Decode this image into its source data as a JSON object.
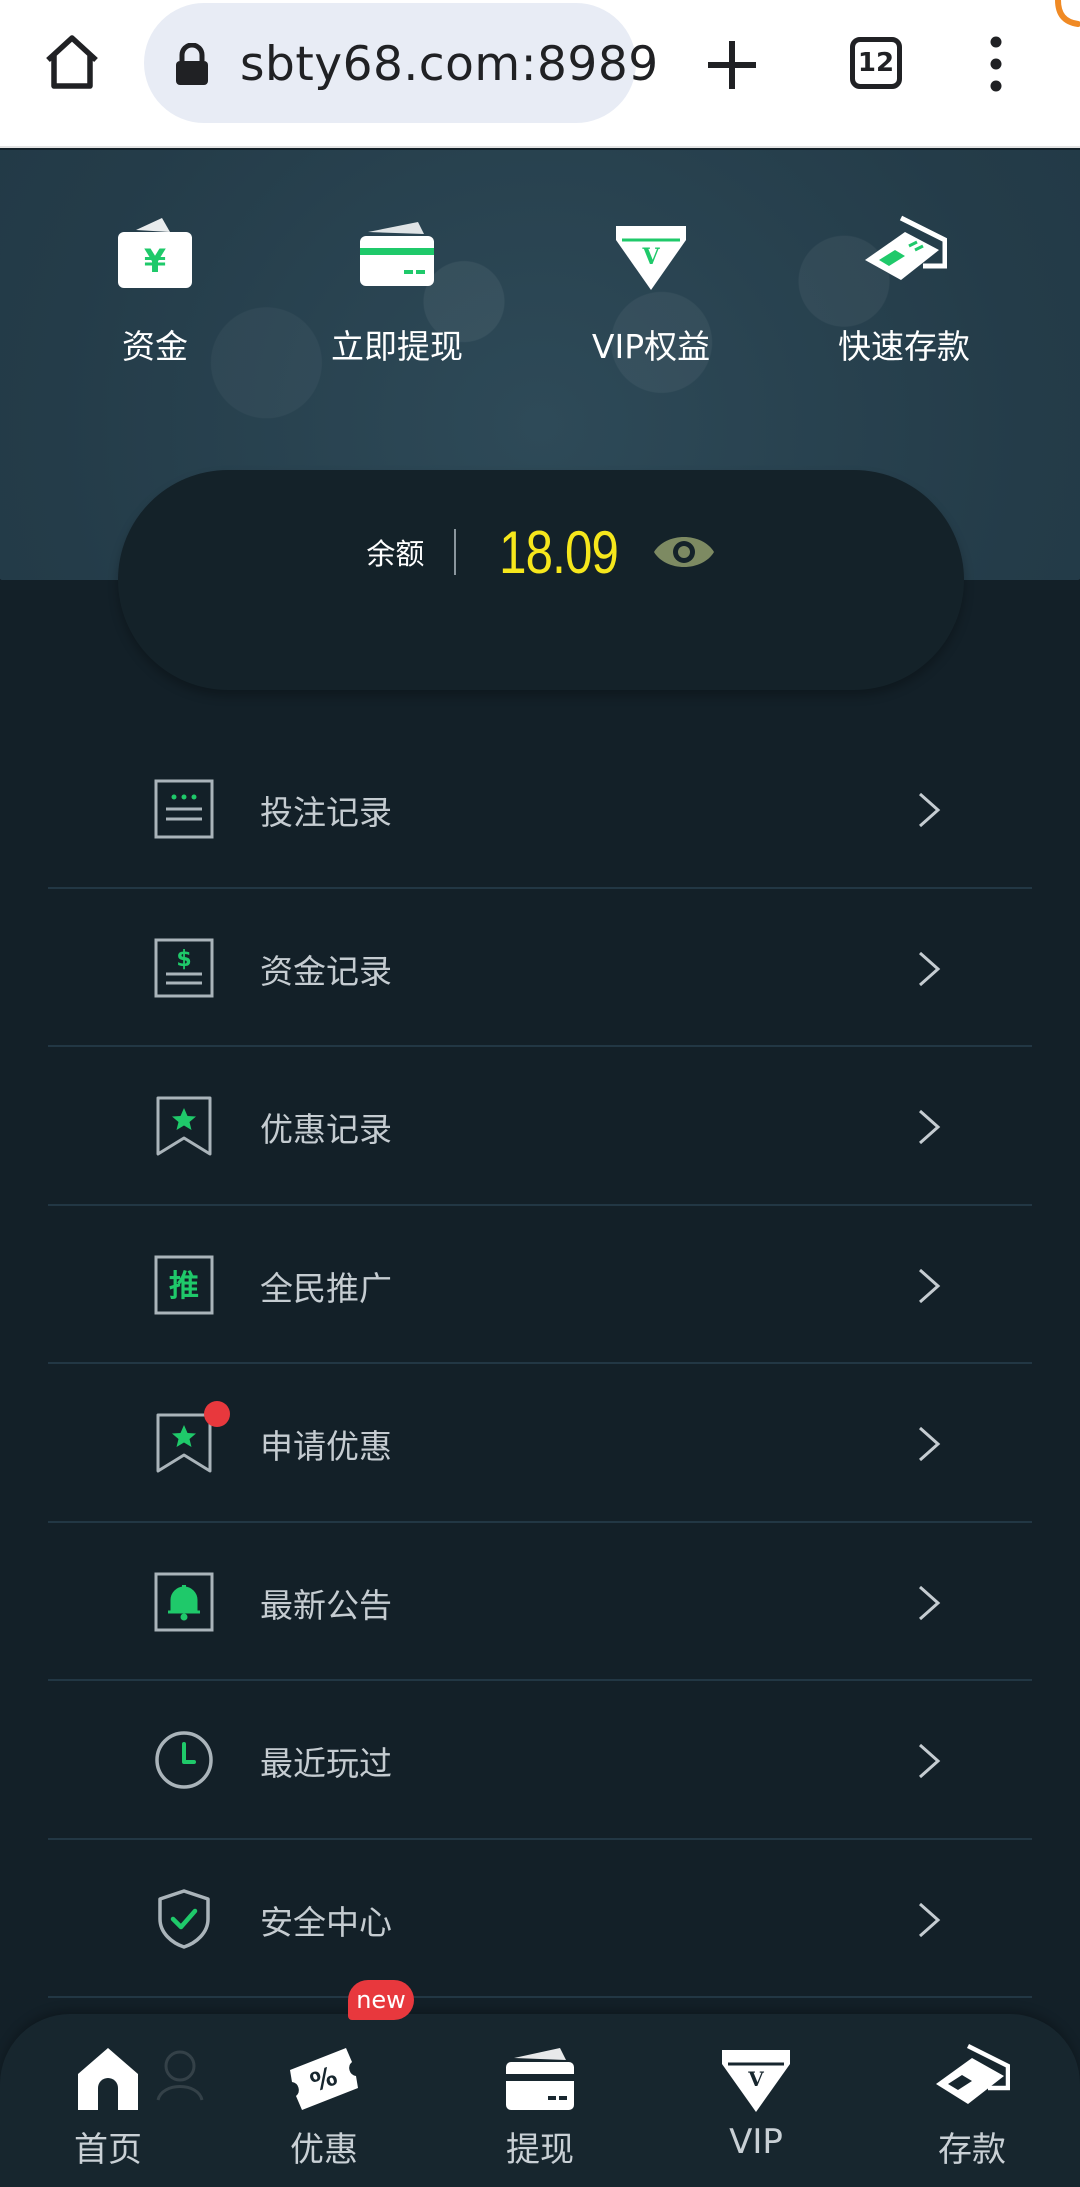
{
  "browser": {
    "url": "sbty68.com:8989",
    "tab_count": "12"
  },
  "quick_actions": [
    {
      "label": "资金",
      "icon": "wallet-yen-icon"
    },
    {
      "label": "立即提现",
      "icon": "card-withdraw-icon"
    },
    {
      "label": "VIP权益",
      "icon": "vip-diamond-icon"
    },
    {
      "label": "快速存款",
      "icon": "card-deposit-icon"
    }
  ],
  "balance": {
    "label": "余额",
    "value": "18.09",
    "value_color": "#f6e71c"
  },
  "menu": [
    {
      "label": "投注记录",
      "icon": "bet-record-icon"
    },
    {
      "label": "资金记录",
      "icon": "fund-record-icon"
    },
    {
      "label": "优惠记录",
      "icon": "promo-record-icon"
    },
    {
      "label": "全民推广",
      "icon": "referral-icon",
      "icon_text": "推"
    },
    {
      "label": "申请优惠",
      "icon": "apply-promo-icon",
      "has_notification": true
    },
    {
      "label": "最新公告",
      "icon": "announcement-bell-icon"
    },
    {
      "label": "最近玩过",
      "icon": "recent-clock-icon"
    },
    {
      "label": "安全中心",
      "icon": "security-shield-icon"
    }
  ],
  "bottom_nav": [
    {
      "label": "首页",
      "icon": "home-icon"
    },
    {
      "label": "优惠",
      "icon": "discount-ticket-icon",
      "badge": "new"
    },
    {
      "label": "提现",
      "icon": "withdraw-card-icon"
    },
    {
      "label": "VIP",
      "icon": "vip-diamond-icon"
    },
    {
      "label": "存款",
      "icon": "deposit-card-icon"
    }
  ],
  "colors": {
    "background": "#132028",
    "accent_green": "#1fc96a",
    "badge_red": "#e8383d"
  }
}
